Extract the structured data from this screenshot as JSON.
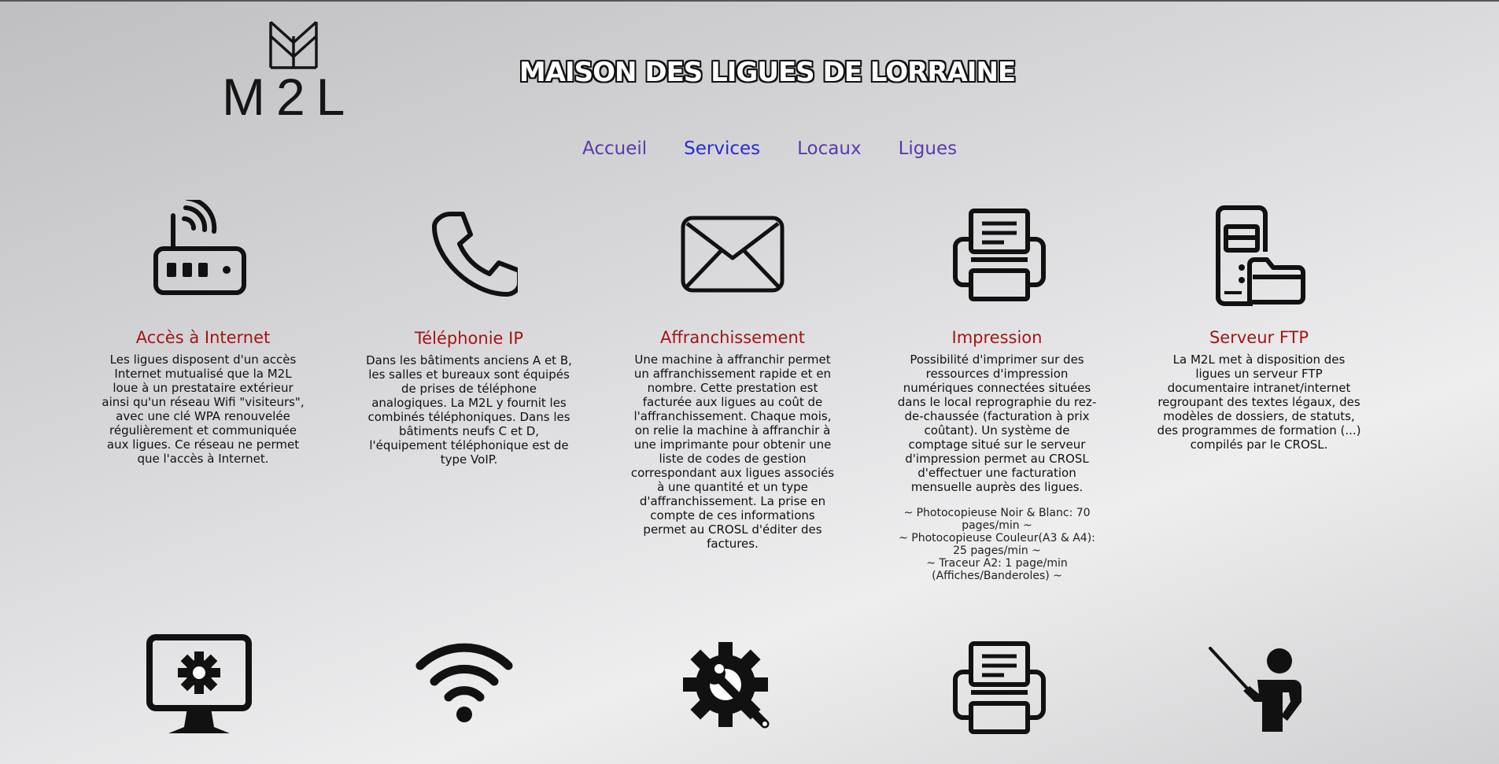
{
  "header": {
    "logo_text": "M2L",
    "title": "MAISON DES LIGUES DE LORRAINE"
  },
  "nav": {
    "items": [
      {
        "label": "Accueil"
      },
      {
        "label": "Services"
      },
      {
        "label": "Locaux"
      },
      {
        "label": "Ligues"
      }
    ],
    "active": "Services",
    "link_color": "#5a3aa8",
    "active_color": "#2a2ad8"
  },
  "services": [
    {
      "icon": "router-icon",
      "title": "Accès à Internet",
      "text": "Les ligues disposent d'un accès Internet mutualisé que la M2L loue à un prestataire extérieur ainsi qu'un réseau Wifi \"visiteurs\", avec une clé WPA renouvelée régulièrement et communiquée aux ligues. Ce réseau ne permet que l'accès à Internet."
    },
    {
      "icon": "phone-icon",
      "title": "Téléphonie IP",
      "text": "Dans les bâtiments anciens A et B, les salles et bureaux sont équipés de prises de téléphone analogiques. La M2L y fournit les combinés téléphoniques. Dans les bâtiments neufs C et D, l'équipement téléphonique est de type VoIP."
    },
    {
      "icon": "envelope-icon",
      "title": "Affranchissement",
      "text": "Une machine à affranchir permet un affranchissement rapide et en nombre. Cette prestation est facturée aux ligues au coût de l'affranchissement. Chaque mois, on relie la machine à affranchir à une imprimante pour obtenir une liste de codes de gestion correspondant aux ligues associés à une quantité et un type d'affranchissement. La prise en compte de ces informations permet au CROSL d'éditer des factures."
    },
    {
      "icon": "printer-icon",
      "title": "Impression",
      "text": "Possibilité d'imprimer sur des ressources d'impression numériques connectées situées dans le local reprographie du rez-de-chaussée (facturation à prix coûtant). Un système de comptage situé sur le serveur d'impression permet au CROSL d'effectuer une facturation mensuelle auprès des ligues.",
      "extra": [
        "~ Photocopieuse Noir & Blanc: 70 pages/min ~",
        "~ Photocopieuse Couleur(A3 & A4): 25 pages/min ~",
        "~ Traceur A2: 1 page/min (Affiches/Banderoles) ~"
      ]
    },
    {
      "icon": "server-folder-icon",
      "title": "Serveur FTP",
      "text": "La M2L met à disposition des ligues un serveur FTP documentaire intranet/internet regroupant des textes légaux, des modèles de dossiers, de statuts, des programmes de formation (...) compilés par le CROSL."
    }
  ],
  "services_row2_icons": [
    "monitor-gear-icon",
    "wifi-icon",
    "gear-wrench-icon",
    "printer-icon",
    "teacher-icon"
  ],
  "colors": {
    "title_red": "#a31515",
    "icon_black": "#111111"
  }
}
